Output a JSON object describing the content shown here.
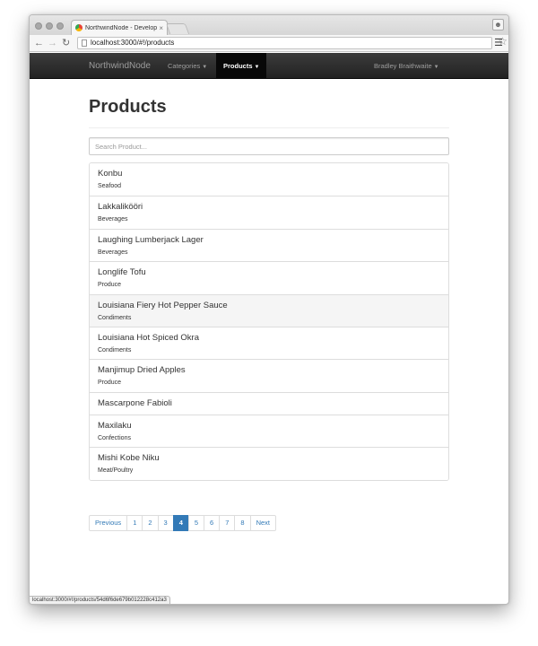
{
  "browser": {
    "tab_title": "NorthwindNode - Develop",
    "tab_close": "×",
    "url": "localhost:3000/#!/products",
    "status_url": "localhost:3000/#!/products/54d6f6de679b012228c412a3"
  },
  "navbar": {
    "brand": "NorthwindNode",
    "items": [
      {
        "label": "Categories"
      },
      {
        "label": "Products"
      }
    ],
    "user": "Bradley Braithwaite"
  },
  "page": {
    "title": "Products",
    "search_placeholder": "Search Product..."
  },
  "products": [
    {
      "name": "Konbu",
      "category": "Seafood"
    },
    {
      "name": "Lakkalikööri",
      "category": "Beverages"
    },
    {
      "name": "Laughing Lumberjack Lager",
      "category": "Beverages"
    },
    {
      "name": "Longlife Tofu",
      "category": "Produce"
    },
    {
      "name": "Louisiana Fiery Hot Pepper Sauce",
      "category": "Condiments"
    },
    {
      "name": "Louisiana Hot Spiced Okra",
      "category": "Condiments"
    },
    {
      "name": "Manjimup Dried Apples",
      "category": "Produce"
    },
    {
      "name": "Mascarpone Fabioli",
      "category": ""
    },
    {
      "name": "Maxilaku",
      "category": "Confections"
    },
    {
      "name": "Mishi Kobe Niku",
      "category": "Meat/Poultry"
    }
  ],
  "pagination": {
    "previous": "Previous",
    "next": "Next",
    "pages": [
      "1",
      "2",
      "3",
      "4",
      "5",
      "6",
      "7",
      "8"
    ],
    "active": "4"
  },
  "colors": {
    "navbar_bg": "#222222",
    "link": "#337ab7",
    "active_page": "#337ab7"
  }
}
